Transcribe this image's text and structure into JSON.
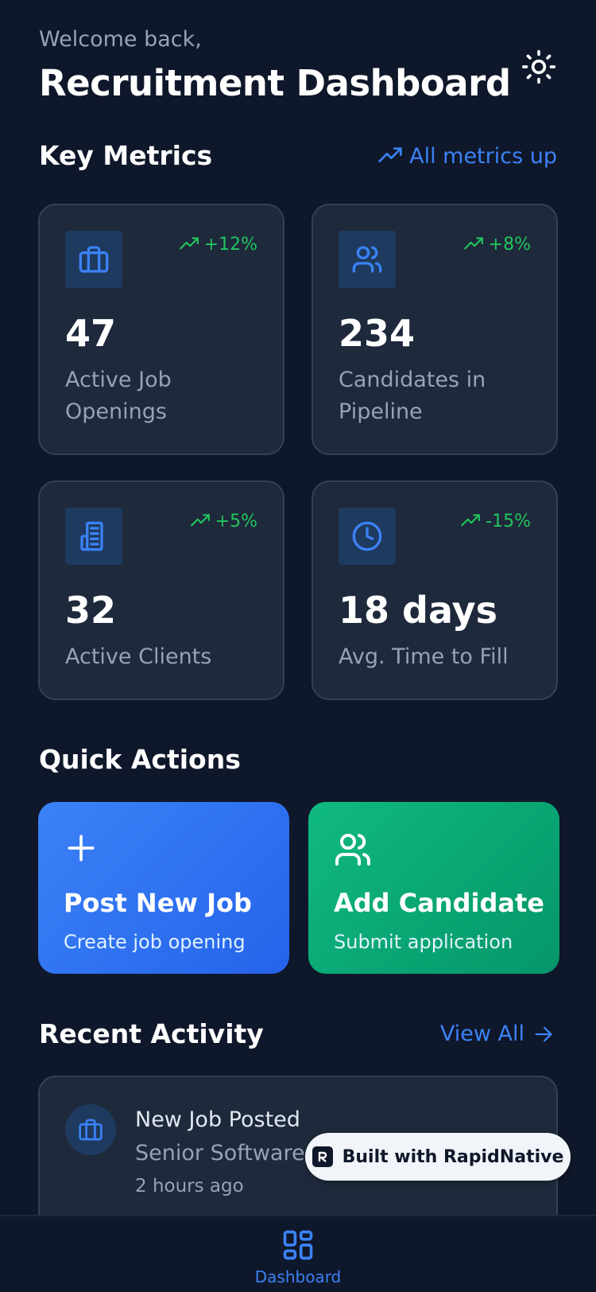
{
  "header": {
    "welcome": "Welcome back,",
    "title": "Recruitment Dashboard"
  },
  "metrics": {
    "title": "Key Metrics",
    "summary": "All metrics up",
    "cards": [
      {
        "value": "47",
        "label": "Active Job Openings",
        "change": "+12%",
        "icon": "briefcase-icon"
      },
      {
        "value": "234",
        "label": "Candidates in Pipeline",
        "change": "+8%",
        "icon": "users-icon"
      },
      {
        "value": "32",
        "label": "Active Clients",
        "change": "+5%",
        "icon": "building-icon"
      },
      {
        "value": "18 days",
        "label": "Avg. Time to Fill",
        "change": "-15%",
        "icon": "clock-icon"
      }
    ]
  },
  "quick_actions": {
    "title": "Quick Actions",
    "items": [
      {
        "title": "Post New Job",
        "subtitle": "Create job opening",
        "icon": "plus-icon"
      },
      {
        "title": "Add Candidate",
        "subtitle": "Submit application",
        "icon": "users-icon"
      }
    ]
  },
  "recent_activity": {
    "title": "Recent Activity",
    "view_all": "View All",
    "items": [
      {
        "title": "New Job Posted",
        "subtitle": "Senior Software",
        "time": "2 hours ago",
        "icon": "briefcase-icon"
      }
    ]
  },
  "badge": {
    "label": "Built with RapidNative"
  },
  "nav": {
    "items": [
      {
        "label": "Dashboard",
        "icon": "grid-icon"
      }
    ]
  },
  "colors": {
    "background": "#0f172a",
    "card": "#1e293b",
    "accent": "#3b82f6",
    "positive": "#22c55e",
    "green_action": "#10b981"
  }
}
